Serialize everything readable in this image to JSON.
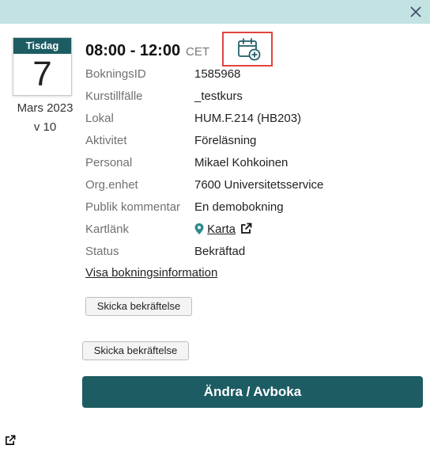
{
  "date": {
    "weekday": "Tisdag",
    "day": "7",
    "month_year": "Mars 2023",
    "week": "v 10"
  },
  "time": {
    "range": "08:00 - 12:00",
    "timezone": "CET"
  },
  "details": [
    {
      "label": "BokningsID",
      "value": "1585968"
    },
    {
      "label": "Kurstillfälle",
      "value": "_testkurs"
    },
    {
      "label": "Lokal",
      "value": "HUM.F.214 (HB203)"
    },
    {
      "label": "Aktivitet",
      "value": "Föreläsning"
    },
    {
      "label": "Personal",
      "value": "Mikael Kohkoinen"
    },
    {
      "label": "Org.enhet",
      "value": "7600 Universitetsservice"
    },
    {
      "label": "Publik kommentar",
      "value": "En demobokning"
    },
    {
      "label": "Kartlänk",
      "value": "Karta"
    },
    {
      "label": "Status",
      "value": "Bekräftad"
    }
  ],
  "links": {
    "visa": "Visa bokningsinformation"
  },
  "buttons": {
    "send_confirmation_1": "Skicka bekräftelse",
    "send_confirmation_2": "Skicka bekräftelse",
    "change_cancel": "Ändra / Avboka"
  },
  "icons": {
    "close": "close-icon",
    "add_to_calendar": "calendar-add-icon",
    "map_pin": "map-pin-icon",
    "external_link": "external-link-icon"
  },
  "colors": {
    "topbar": "#c3e3e3",
    "primary": "#1d5c63",
    "highlight": "#e0443e",
    "pin": "#2e8b8b"
  }
}
